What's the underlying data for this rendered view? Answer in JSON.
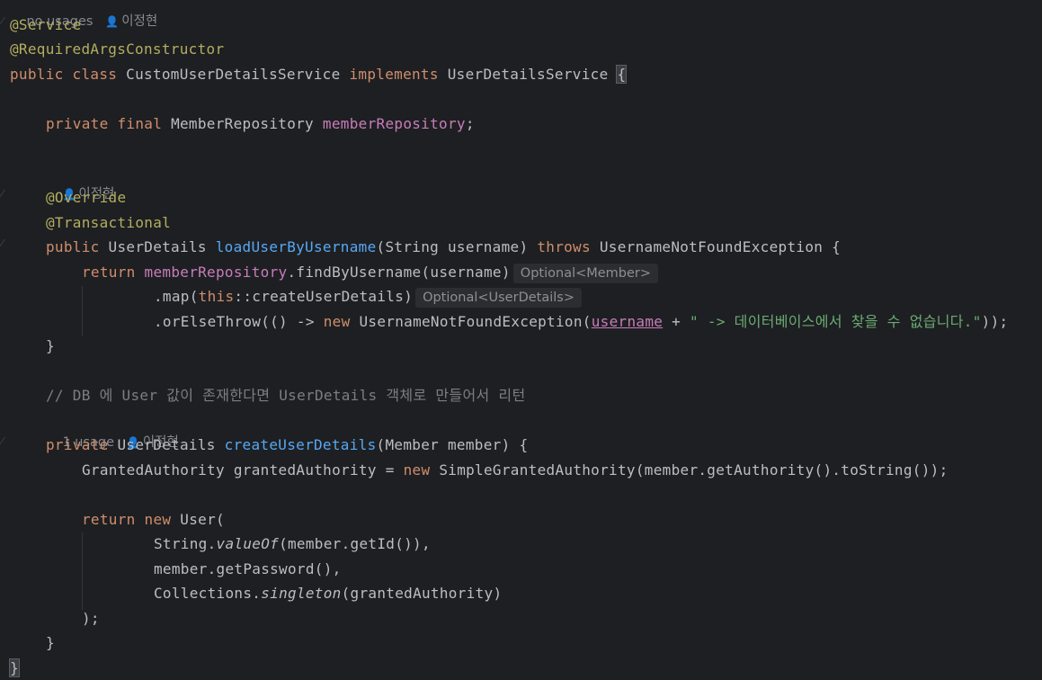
{
  "hints": {
    "top": {
      "usage": "no usages",
      "author": "이정현"
    },
    "load_author": "이정현",
    "create_usage": "1 usage",
    "create_author": "이정현"
  },
  "inlays": {
    "optional_member": "Optional<Member>",
    "optional_user_details": "Optional<UserDetails>"
  },
  "code": {
    "l1_ann": "@Service",
    "l2_ann": "@RequiredArgsConstructor",
    "l3_kw": "public class ",
    "l3_name": "CustomUserDetailsService ",
    "l3_impl": "implements ",
    "l3_iface": "UserDetailsService ",
    "l3_brace": "{",
    "l4_kw": "private final ",
    "l4_type": "MemberRepository ",
    "l4_field": "memberRepository",
    "l4_semi": ";",
    "l5_ann": "@Override",
    "l6_ann": "@Transactional",
    "l7_kw": "public ",
    "l7_type": "UserDetails ",
    "l7_fn": "loadUserByUsername",
    "l7_params": "(String username) ",
    "l7_throws": "throws ",
    "l7_rest": "UsernameNotFoundException {",
    "l8_kw": "return ",
    "l8_field": "memberRepository",
    "l8_rest": ".findByUsername(username)",
    "l9_a": ".map(",
    "l9_this": "this",
    "l9_b": "::createUserDetails)",
    "l10_a": ".orElseThrow(() -> ",
    "l10_new": "new ",
    "l10_b": "UsernameNotFoundException(",
    "l10_param": "username",
    "l10_c": " + ",
    "l10_str": "\" -> 데이터베이스에서 찾을 수 없습니다.\"",
    "l10_d": "));",
    "l11": "}",
    "l12_comment": "// DB 에 User 값이 존재한다면 UserDetails 객체로 만들어서 리턴",
    "l13_kw": "private ",
    "l13_type": "UserDetails ",
    "l13_fn": "createUserDetails",
    "l13_rest": "(Member member) {",
    "l14_a": "GrantedAuthority grantedAuthority = ",
    "l14_new": "new ",
    "l14_b": "SimpleGrantedAuthority(member.getAuthority().toString());",
    "l15_kw": "return ",
    "l15_new": "new ",
    "l15_b": "User(",
    "l16_a": "String.",
    "l16_it": "valueOf",
    "l16_b": "(member.getId()),",
    "l17": "member.getPassword(),",
    "l18_a": "Collections.",
    "l18_it": "singleton",
    "l18_b": "(grantedAuthority)",
    "l19": ");",
    "l20": "}",
    "l21": "}"
  }
}
